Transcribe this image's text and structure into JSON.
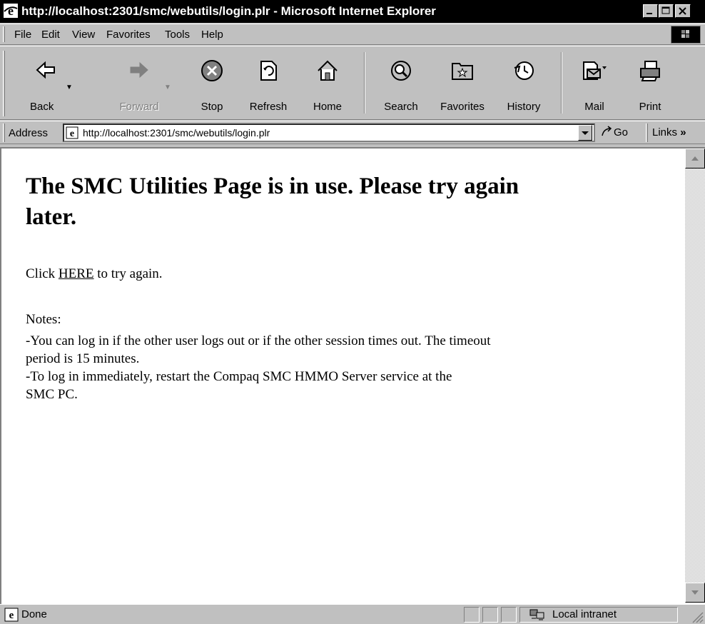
{
  "window": {
    "title": "http://localhost:2301/smc/webutils/login.plr - Microsoft Internet Explorer"
  },
  "menu": {
    "file": "File",
    "edit": "Edit",
    "view": "View",
    "favorites": "Favorites",
    "tools": "Tools",
    "help": "Help"
  },
  "toolbar": {
    "back": "Back",
    "forward": "Forward",
    "stop": "Stop",
    "refresh": "Refresh",
    "home": "Home",
    "search": "Search",
    "favorites": "Favorites",
    "history": "History",
    "mail": "Mail",
    "print": "Print"
  },
  "address": {
    "label": "Address",
    "url": "http://localhost:2301/smc/webutils/login.plr",
    "go": "Go",
    "links": "Links"
  },
  "page": {
    "heading": "The SMC Utilities Page is in use. Please try again later.",
    "click_prefix": "Click",
    "click_link": "HERE",
    "click_suffix": "to try again.",
    "notes_title": "Notes:",
    "note1_line1": "-You can log in if the other user logs out or if the other session times out. The timeout",
    "note1_line2": "period is 15 minutes.",
    "note2_line1": "-To log in immediately, restart the Compaq SMC HMMO Server service at the",
    "note2_line2": "SMC PC."
  },
  "status": {
    "text": "Done",
    "zone": "Local intranet"
  }
}
